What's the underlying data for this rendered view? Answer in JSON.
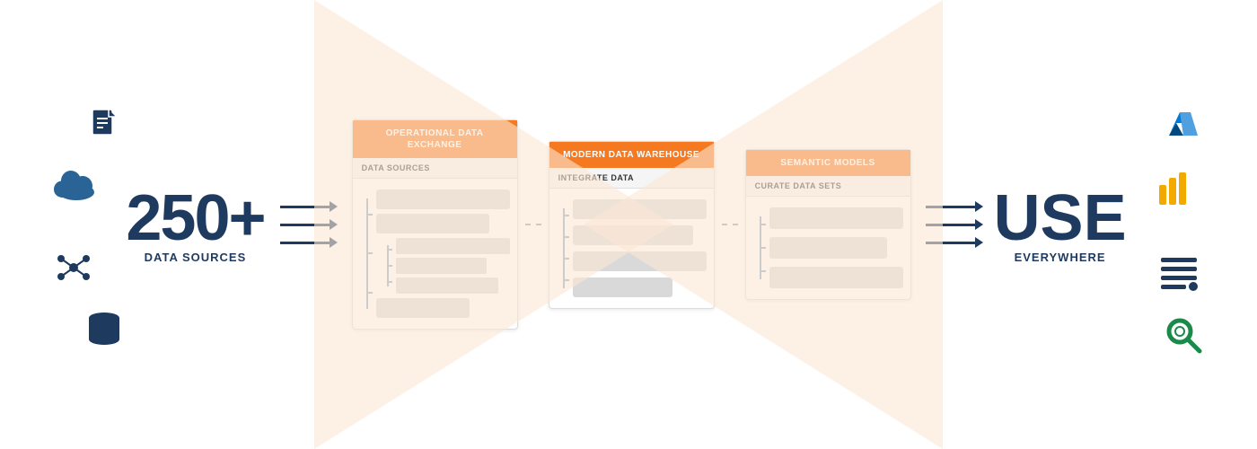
{
  "page": {
    "background_color": "#ffffff",
    "bowtie_color": "#fde8d8"
  },
  "left": {
    "number": "250+",
    "subtitle": "DATA SOURCES",
    "icons": [
      "document",
      "cloud",
      "network",
      "database"
    ]
  },
  "right": {
    "main": "USE",
    "subtitle": "EVERYWHERE",
    "icons": [
      "azure",
      "powerbi",
      "tableau",
      "search"
    ]
  },
  "panels": [
    {
      "header": "OPERATIONAL DATA EXCHANGE",
      "subheader": "DATA SOURCES",
      "bars": [
        {
          "width": "100%"
        },
        {
          "width": "85%"
        },
        {
          "width": "100%"
        },
        {
          "width": "75%"
        },
        {
          "width": "100%"
        },
        {
          "width": "60%"
        },
        {
          "width": "70%"
        }
      ]
    },
    {
      "header": "MODERN DATA WAREHOUSE",
      "subheader": "INTEGRATE DATA",
      "bars": [
        {
          "width": "100%"
        },
        {
          "width": "90%"
        },
        {
          "width": "100%"
        },
        {
          "width": "80%"
        },
        {
          "width": "65%"
        }
      ]
    },
    {
      "header": "SEMANTIC MODELS",
      "subheader": "CURATE DATA SETS",
      "bars": [
        {
          "width": "100%"
        },
        {
          "width": "85%"
        },
        {
          "width": "100%"
        },
        {
          "width": "75%"
        }
      ]
    }
  ],
  "arrows": {
    "left_label": "triple arrows left",
    "right_label": "triple arrows right"
  }
}
